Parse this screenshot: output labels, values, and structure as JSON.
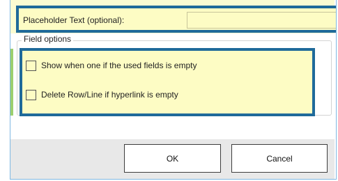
{
  "placeholder": {
    "label": "Placeholder Text (optional):",
    "value": ""
  },
  "field_options": {
    "title": "Field options",
    "options": [
      {
        "label": "Show when one if the used fields is empty",
        "checked": false
      },
      {
        "label": "Delete Row/Line if hyperlink is empty",
        "checked": false
      }
    ]
  },
  "buttons": {
    "ok_label": "OK",
    "cancel_label": "Cancel"
  },
  "colors": {
    "highlight_border": "#1f6a9a",
    "highlight_fill": "#fdfcc4",
    "footer": "#e8e8e8",
    "accent_strip": "#9ccf6f"
  }
}
